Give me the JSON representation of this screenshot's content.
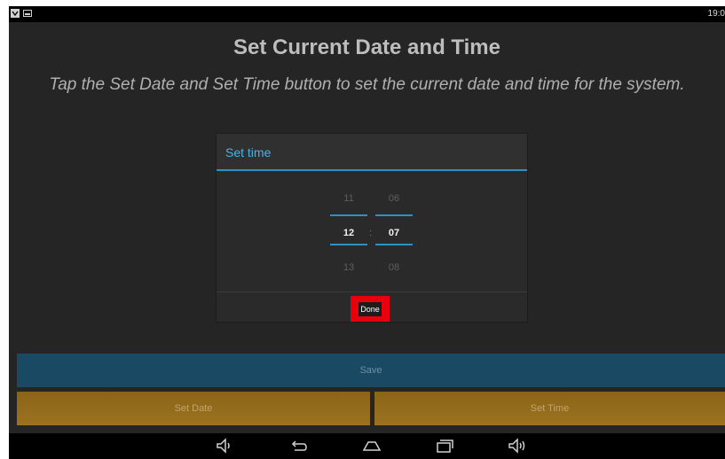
{
  "statusbar": {
    "clock": "19:0",
    "icons": [
      "notification-icon",
      "image-icon"
    ]
  },
  "page": {
    "title": "Set Current Date and Time",
    "subtitle": "Tap the Set Date and Set Time button to set the current date and time for the system."
  },
  "dialog": {
    "title": "Set time",
    "hours": {
      "prev": "11",
      "current": "12",
      "next": "13"
    },
    "minutes": {
      "prev": "06",
      "current": "07",
      "next": "08"
    },
    "separator": ":",
    "done_label": "Done",
    "accent_color": "#2f90c4",
    "highlight_color": "#e8000d"
  },
  "buttons": {
    "save": "Save",
    "set_date": "Set Date",
    "set_time": "Set Time"
  },
  "navbar": [
    "volume-down-icon",
    "back-icon",
    "home-icon",
    "recent-apps-icon",
    "volume-up-icon"
  ]
}
